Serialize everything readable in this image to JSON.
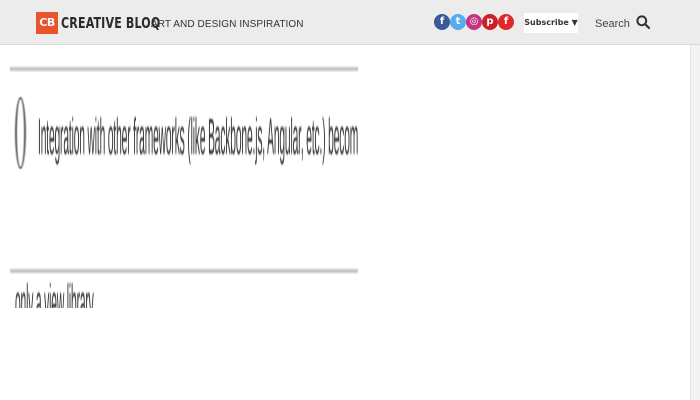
{
  "header": {
    "logo_badge": "CB",
    "logo_text": "CREATIVE BLOQ",
    "tagline": "ART AND DESIGN INSPIRATION",
    "social": [
      {
        "name": "facebook",
        "glyph": "f",
        "color": "#3b5998"
      },
      {
        "name": "twitter",
        "glyph": "t",
        "color": "#55acee"
      },
      {
        "name": "instagram",
        "glyph": "◎",
        "color": "#c13584"
      },
      {
        "name": "pinterest",
        "glyph": "p",
        "color": "#cb2027"
      },
      {
        "name": "flipboard",
        "glyph": "f",
        "color": "#e12828"
      }
    ],
    "subscribe_label": "Subscribe ▼",
    "search_label": "Search"
  },
  "article_image": {
    "line1": "Integration with other frameworks (like Backbone.js, Angular, etc.) becomes easier because it is",
    "line2": "only a view library"
  },
  "colors": {
    "header_bg": "#ececec",
    "brand": "#e8542c"
  }
}
